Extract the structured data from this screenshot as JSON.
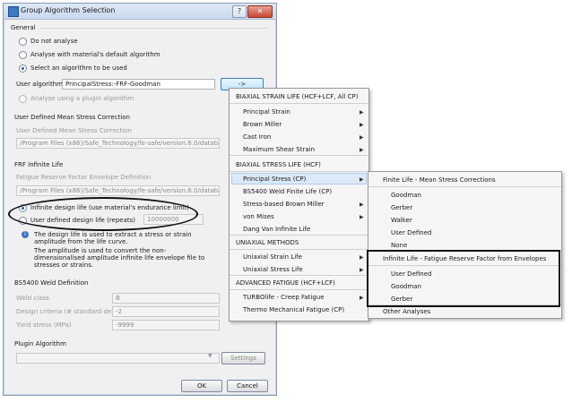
{
  "dialog": {
    "title": "Group Algorithm Selection",
    "general_label": "General",
    "radio_options": [
      "Do not analyse",
      "Analyse with material's default algorithm",
      "Select an algorithm to be used"
    ],
    "user_algorithm_label": "User algorithm",
    "user_algorithm_value": "PrincipalStress:-FRF-Goodman",
    "select_button": "->",
    "plugin_option": "Analyse using a plugin algorithm",
    "mean_stress_section": "User Defined Mean Stress Correction",
    "mean_stress_label": "User Defined Mean Stress Correction",
    "mean_stress_path": "/Program Files (x86)/Safe_Technology/fe-safe/version.6.0/database/goodman.msc",
    "frf_section": "FRF Infinite Life",
    "frf_label": "Fatigue Reserve Factor Envelope Definition",
    "frf_path": "/Program Files (x86)/Safe_Technology/fe-safe/version.6.0/database/goodman.frf",
    "infinite_option": "Infinite design life (use material's endurance limit)",
    "user_life_option": "User defined design life (repeats)",
    "user_life_value": "10000000",
    "info_text_1": "The design life is used to extract a stress or strain amplitude from the life curve.",
    "info_text_2": "The amplitude is used to convert the non-dimensionalised amplitude infinite life envelope file to stresses or strains.",
    "bs5400_section": "BS5400 Weld Definition",
    "weld_class_label": "Weld class",
    "weld_class_value": "B",
    "design_criteria_label": "Design criteria (# standard devns)",
    "design_criteria_value": "-2",
    "yield_label": "Yield stress (MPa)",
    "yield_value": "-9999",
    "plugin_section": "Plugin Algorithm",
    "settings_button": "Settings",
    "ok_button": "OK",
    "cancel_button": "Cancel"
  },
  "menu1": {
    "headers": [
      "BIAXIAL STRAIN LIFE (HCF+LCF, All CP)",
      "BIAXIAL STRESS LIFE (HCF)",
      "UNIAXIAL METHODS",
      "ADVANCED FATIGUE (HCF+LCF)"
    ],
    "strain_items": [
      "Principal Strain",
      "Brown Miller",
      "Cast Iron",
      "Maximum Shear Strain"
    ],
    "stress_items": [
      "Principal Stress (CP)",
      "BS5400 Weld Finite Life (CP)",
      "Stress-based Brown Miller",
      "von Mises",
      "Dang Van Infinite Life"
    ],
    "uniaxial_items": [
      "Uniaxial Strain Life",
      "Uniaxial Stress Life"
    ],
    "advanced_items": [
      "TURBOlife - Creep Fatigue",
      "Thermo Mechanical Fatigue (CP)"
    ]
  },
  "menu2": {
    "finite_header": "Finite Life - Mean Stress Corrections",
    "finite_items": [
      "Goodman",
      "Gerber",
      "Walker",
      "User Defined",
      "None"
    ],
    "infinite_header": "Infinite Life - Fatigue Reserve Factor from Envelopes",
    "infinite_items": [
      "User Defined",
      "Goodman",
      "Gerber"
    ],
    "other": "Other Analyses"
  },
  "colors": {
    "highlight": "#dce9f8",
    "title_bar": "#c9d9ef",
    "annotation": "#111111"
  }
}
